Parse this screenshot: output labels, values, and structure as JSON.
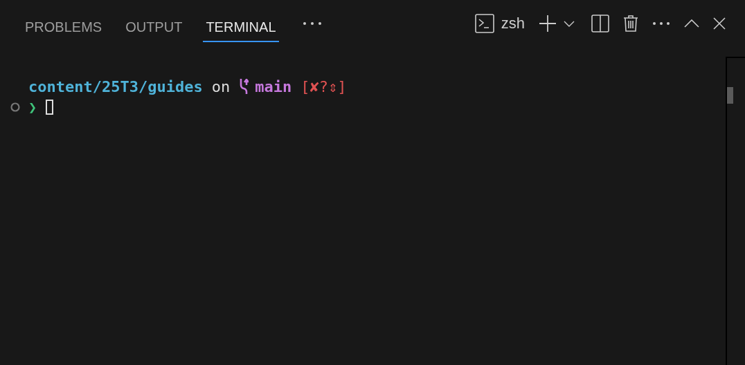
{
  "tabs": [
    {
      "label": "PROBLEMS",
      "selected": false
    },
    {
      "label": "OUTPUT",
      "selected": false
    },
    {
      "label": "TERMINAL",
      "selected": true
    }
  ],
  "terminal_name": "zsh",
  "prompt": {
    "path": "content/25T3/guides",
    "connector": "on",
    "branch": "main",
    "git_status": "[✘?⇕]",
    "symbol": "❯"
  }
}
